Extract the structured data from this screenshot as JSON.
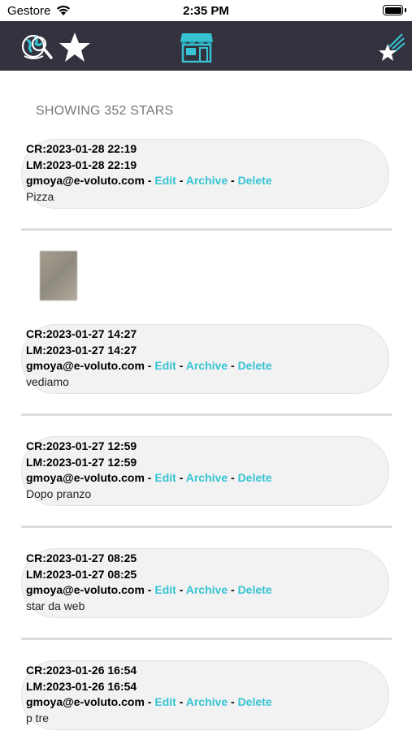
{
  "status_bar": {
    "carrier": "Gestore",
    "time": "2:35 PM"
  },
  "nav": {
    "left_icons": [
      "globe-search-icon",
      "star-icon"
    ],
    "center_icon": "shop-icon",
    "right_icon": "shooting-star-icon"
  },
  "showing_label": "SHOWING 352 STARS",
  "actions": {
    "edit": "Edit",
    "archive": "Archive",
    "delete": "Delete",
    "separator": "-"
  },
  "stars": [
    {
      "cr": "CR:2023-01-28 22:19",
      "lm": "LM:2023-01-28 22:19",
      "user": "gmoya@e-voluto.com",
      "text": "Pizza"
    },
    {
      "cr": "CR:2023-01-27 14:27",
      "lm": "LM:2023-01-27 14:27",
      "user": "gmoya@e-voluto.com",
      "text": "vediamo",
      "has_image": true
    },
    {
      "cr": "CR:2023-01-27 12:59",
      "lm": "LM:2023-01-27 12:59",
      "user": "gmoya@e-voluto.com",
      "text": "Dopo pranzo"
    },
    {
      "cr": "CR:2023-01-27 08:25",
      "lm": "LM:2023-01-27 08:25",
      "user": "gmoya@e-voluto.com",
      "text": "star da web"
    },
    {
      "cr": "CR:2023-01-26 16:54",
      "lm": "LM:2023-01-26 16:54",
      "user": "gmoya@e-voluto.com",
      "text": "p tre"
    }
  ],
  "colors": {
    "navbar": "#333340",
    "accent": "#36c4d4",
    "bubble": "#f2f2f2"
  }
}
